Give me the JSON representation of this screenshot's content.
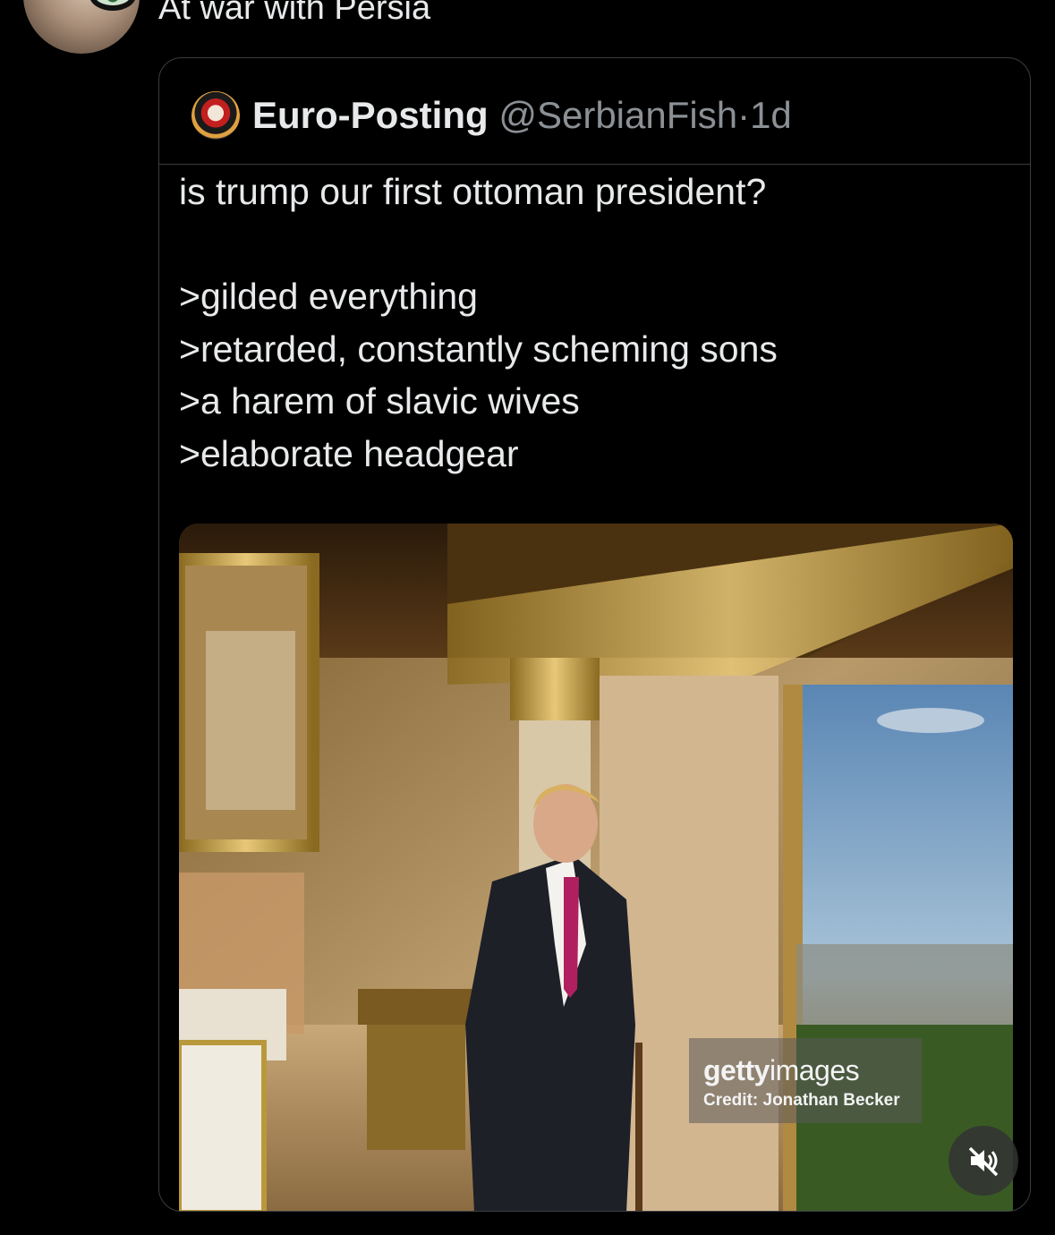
{
  "parent_post": {
    "text": "At war with Persia"
  },
  "quoted_post": {
    "display_name": "Euro-Posting",
    "handle": "@SerbianFish",
    "separator": "·",
    "age": "1d",
    "lines": [
      "is trump our first ottoman president?",
      "",
      ">gilded everything",
      ">retarded, constantly scheming sons",
      ">a harem of slavic wives",
      ">elaborate headgear"
    ]
  },
  "media": {
    "watermark_brand_bold": "getty",
    "watermark_brand_light": "images",
    "watermark_credit": "Credit: Jonathan Becker",
    "mute_icon": "speaker-muted-icon"
  },
  "colors": {
    "background": "#000000",
    "text_primary": "#e7e9ea",
    "text_secondary": "#8b9095",
    "border": "#3a3d40"
  }
}
